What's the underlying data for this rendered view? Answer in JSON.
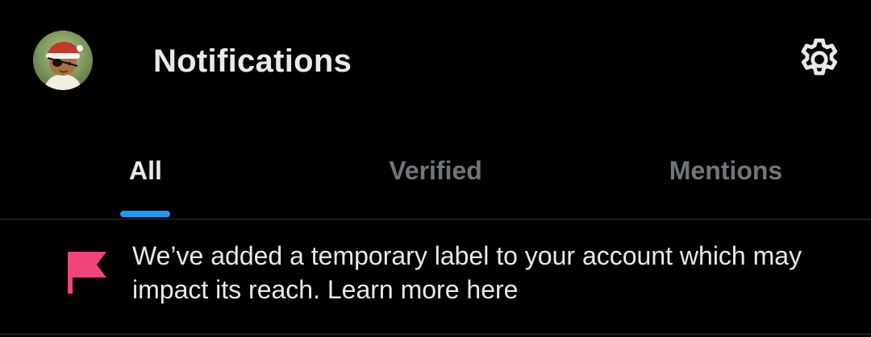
{
  "header": {
    "title": "Notifications",
    "avatar_icon": "avatar-pirate-santa-icon",
    "settings_icon": "gear-icon"
  },
  "tabs": [
    {
      "label": "All",
      "active": true
    },
    {
      "label": "Verified",
      "active": false
    },
    {
      "label": "Mentions",
      "active": false
    }
  ],
  "notice": {
    "icon": "flag-icon",
    "text": "We’ve added a temporary label to your account which may impact its reach.",
    "link_text": "Learn more here"
  },
  "colors": {
    "background": "#000000",
    "text_primary": "#e7e9ea",
    "text_secondary": "#71767b",
    "accent": "#1d9bf0",
    "flag": "#f0457b",
    "divider": "#2f3336"
  }
}
